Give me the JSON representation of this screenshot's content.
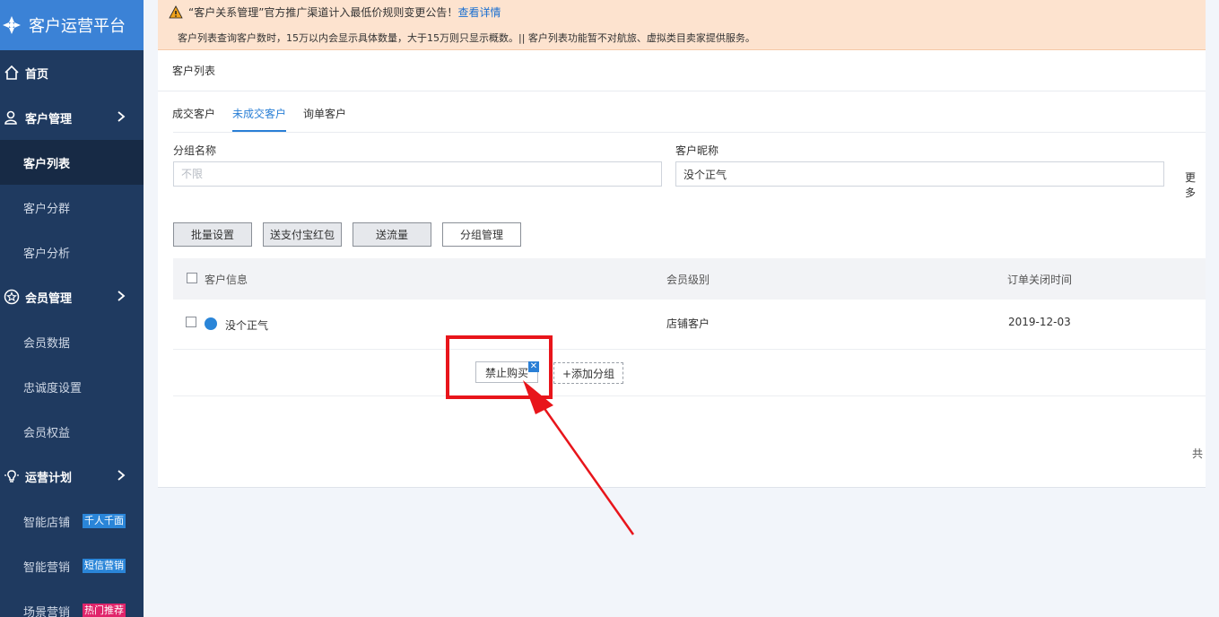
{
  "sidebar": {
    "brand": "客户运营平台",
    "items": [
      {
        "label": "首页"
      },
      {
        "label": "客户管理"
      },
      {
        "label": "客户列表"
      },
      {
        "label": "客户分群"
      },
      {
        "label": "客户分析"
      },
      {
        "label": "会员管理"
      },
      {
        "label": "会员数据"
      },
      {
        "label": "忠诚度设置"
      },
      {
        "label": "会员权益"
      },
      {
        "label": "运营计划"
      },
      {
        "label": "智能店铺",
        "badge": "千人千面",
        "badge_color": "#2a85d8"
      },
      {
        "label": "智能营销",
        "badge": "短信营销",
        "badge_color": "#2a85d8"
      },
      {
        "label": "场景营销",
        "badge": "热门推荐",
        "badge_color": "#e0246a"
      }
    ]
  },
  "notice": {
    "text": "“客户关系管理”官方推广渠道计入最低价规则变更公告！",
    "link": "查看详情",
    "sub": "客户列表查询客户数时，15万以内会显示具体数量，大于15万则只显示概数。|| 客户列表功能暂不对航旅、虚拟类目卖家提供服务。"
  },
  "breadcrumb": "客户列表",
  "tabs": [
    "成交客户",
    "未成交客户",
    "询单客户"
  ],
  "active_tab": "未成交客户",
  "filters": {
    "group_label": "分组名称",
    "group_placeholder": "不限",
    "nick_label": "客户昵称",
    "nick_value": "没个正气",
    "more": "更多"
  },
  "actions": [
    "批量设置",
    "送支付宝红包",
    "送流量",
    "分组管理"
  ],
  "table": {
    "columns": [
      "客户信息",
      "会员级别",
      "订单关闭时间"
    ],
    "rows": [
      {
        "name": "没个正气",
        "level": "店铺客户",
        "closed": "2019-12-03"
      }
    ],
    "tag": "禁止购买",
    "add_group": "+添加分组"
  },
  "footer_count": "共",
  "colors": {
    "accent": "#2a7fd6",
    "sidebar": "#1f3a60",
    "highlight": "#e8151b"
  }
}
